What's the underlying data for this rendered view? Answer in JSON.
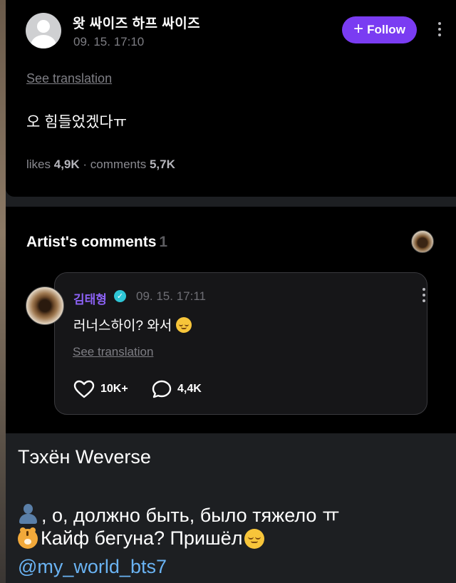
{
  "post": {
    "username": "왓 싸이즈 하프 싸이즈",
    "timestamp": "09. 15. 17:10",
    "follow_label": "Follow",
    "see_translation": "See translation",
    "text": "오 힘들었겠다ㅠ",
    "likes_label": "likes",
    "likes_count": "4,9K",
    "comments_label": "comments",
    "comments_count": "5,7K"
  },
  "artist_comments": {
    "title": "Artist's comments",
    "count": "1",
    "comment": {
      "author": "김태형",
      "timestamp": "09. 15. 17:11",
      "text": "러너스하이? 와서",
      "see_translation": "See translation",
      "likes": "10K+",
      "replies": "4,4K"
    }
  },
  "caption": {
    "title": "Тэхён Weverse",
    "line1": ", о, должно быть, было тяжело ㅠ",
    "line2": "Кайф бегуна? Пришёл",
    "handle": "@my_world_bts7"
  },
  "colors": {
    "accent_purple": "#7a3cf2",
    "author_purple": "#8c62f5",
    "verified_teal": "#2ec6d6",
    "link_blue": "#6ab3f3"
  }
}
